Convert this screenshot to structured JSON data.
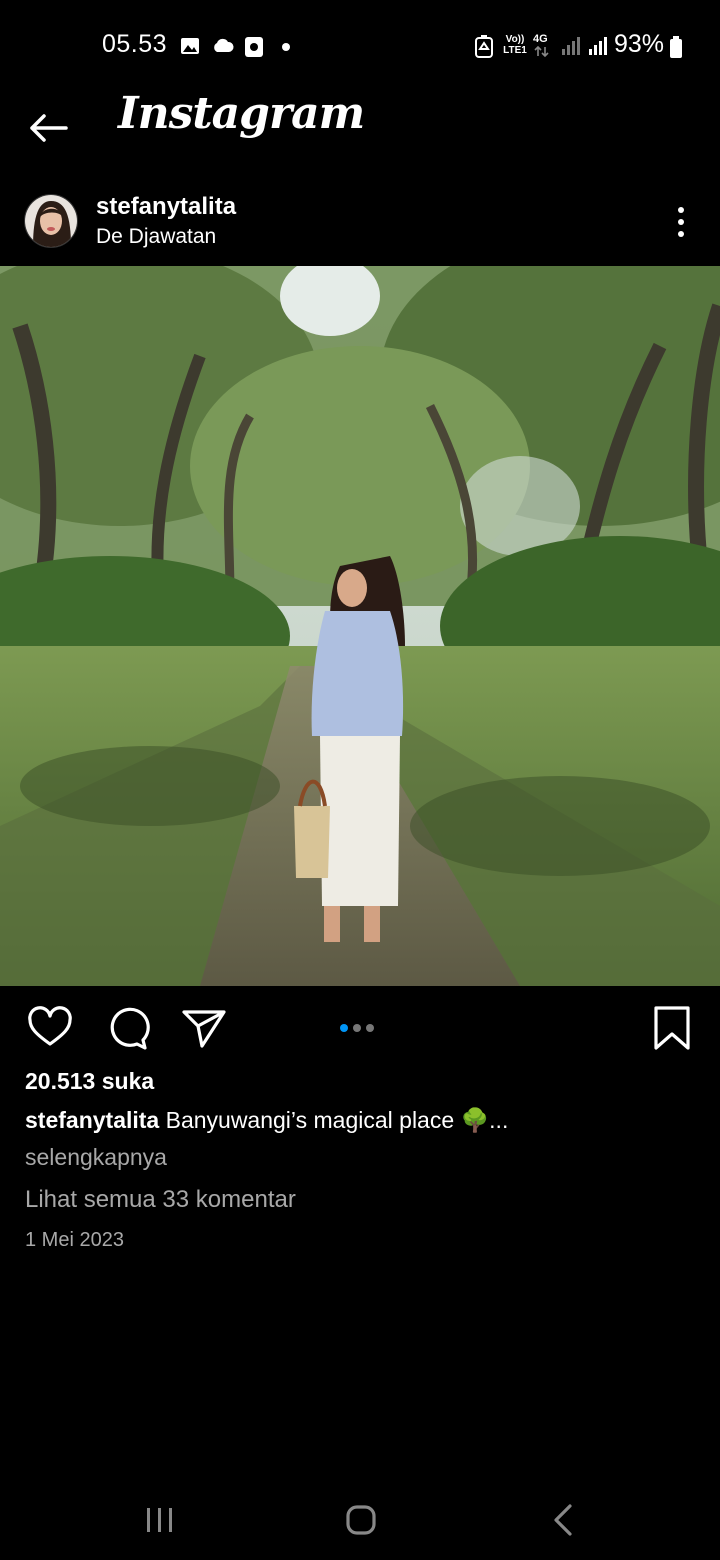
{
  "status_bar": {
    "time": "05.53",
    "battery": "93%",
    "network_4g": "4G",
    "volte": "Vo))",
    "lte": "LTE1",
    "icons": [
      "gallery-icon",
      "cloud-icon",
      "screenshot-icon",
      "notification-dot-icon",
      "recycle-icon",
      "volte-icon",
      "4g-icon",
      "signal-1-icon",
      "signal-2-icon",
      "battery-icon"
    ]
  },
  "header": {
    "logo": "Instagram",
    "back_icon": "back-arrow-icon"
  },
  "post": {
    "username": "stefanytalita",
    "location": "De Djawatan",
    "likes": "20.513 suka",
    "caption_user": "stefanytalita",
    "caption_text": "Banyuwangi’s magical place 🌳...",
    "more_label": "selengkapnya",
    "comments_label": "Lihat semua 33 komentar",
    "date": "1 Mei 2023",
    "carousel": {
      "count": 3,
      "active": 0
    }
  },
  "colors": {
    "background": "#000000",
    "text": "#ffffff",
    "muted": "#a8a8a8",
    "carousel_active": "#0095f6"
  }
}
